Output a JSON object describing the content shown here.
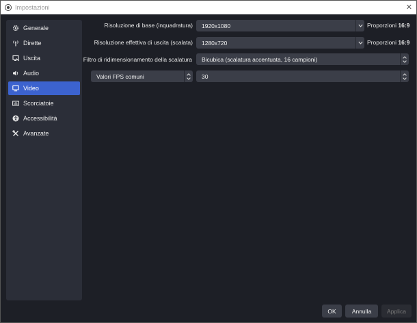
{
  "window": {
    "title": "Impostazioni",
    "close_glyph": "✕"
  },
  "sidebar": {
    "items": [
      {
        "label": "Generale",
        "icon": "gear-icon",
        "active": false
      },
      {
        "label": "Dirette",
        "icon": "broadcast-icon",
        "active": false
      },
      {
        "label": "Uscita",
        "icon": "output-icon",
        "active": false
      },
      {
        "label": "Audio",
        "icon": "speaker-icon",
        "active": false
      },
      {
        "label": "Video",
        "icon": "monitor-icon",
        "active": true
      },
      {
        "label": "Scorciatoie",
        "icon": "keyboard-icon",
        "active": false
      },
      {
        "label": "Accessibilità",
        "icon": "accessibility-icon",
        "active": false
      },
      {
        "label": "Avanzate",
        "icon": "tools-icon",
        "active": false
      }
    ]
  },
  "video": {
    "base_resolution": {
      "label": "Risoluzione di base (inquadratura)",
      "value": "1920x1080",
      "ratio_prefix": "Proporzioni",
      "ratio_value": "16:9"
    },
    "output_resolution": {
      "label": "Risoluzione effettiva di uscita (scalata)",
      "value": "1280x720",
      "ratio_prefix": "Proporzioni",
      "ratio_value": "16:9"
    },
    "downscale_filter": {
      "label": "Filtro di ridimensionamento della scalatura",
      "value": "Bicubica (scalatura accentuata, 16 campioni)"
    },
    "fps": {
      "type_value": "Valori FPS comuni",
      "value": "30"
    }
  },
  "buttons": {
    "ok": "OK",
    "cancel": "Annulla",
    "apply": "Applica"
  },
  "colors": {
    "background": "#1d1f26",
    "sidebar": "#2b2e38",
    "accent": "#3c63cf",
    "control": "#3b3e48"
  }
}
